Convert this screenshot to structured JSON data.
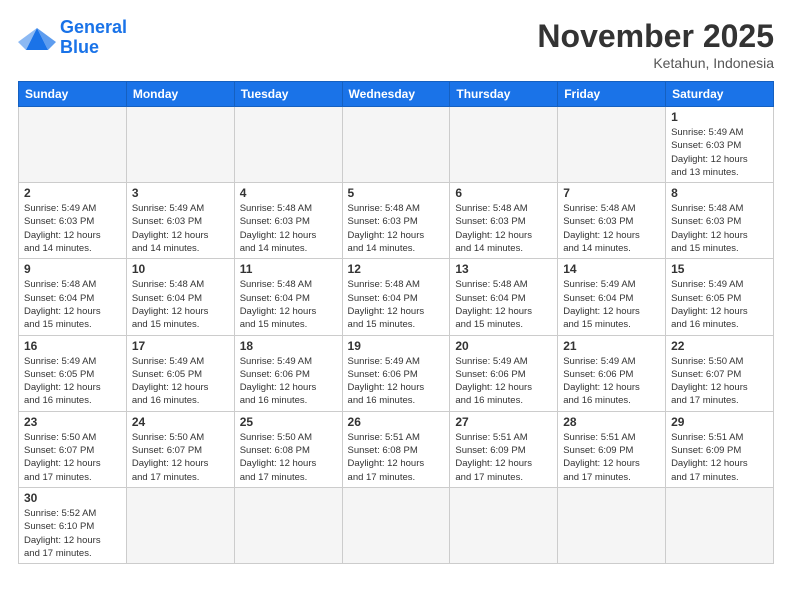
{
  "header": {
    "logo_general": "General",
    "logo_blue": "Blue",
    "month_title": "November 2025",
    "location": "Ketahun, Indonesia"
  },
  "weekdays": [
    "Sunday",
    "Monday",
    "Tuesday",
    "Wednesday",
    "Thursday",
    "Friday",
    "Saturday"
  ],
  "days": {
    "d1": {
      "num": "1",
      "info": "Sunrise: 5:49 AM\nSunset: 6:03 PM\nDaylight: 12 hours\nand 13 minutes."
    },
    "d2": {
      "num": "2",
      "info": "Sunrise: 5:49 AM\nSunset: 6:03 PM\nDaylight: 12 hours\nand 14 minutes."
    },
    "d3": {
      "num": "3",
      "info": "Sunrise: 5:49 AM\nSunset: 6:03 PM\nDaylight: 12 hours\nand 14 minutes."
    },
    "d4": {
      "num": "4",
      "info": "Sunrise: 5:48 AM\nSunset: 6:03 PM\nDaylight: 12 hours\nand 14 minutes."
    },
    "d5": {
      "num": "5",
      "info": "Sunrise: 5:48 AM\nSunset: 6:03 PM\nDaylight: 12 hours\nand 14 minutes."
    },
    "d6": {
      "num": "6",
      "info": "Sunrise: 5:48 AM\nSunset: 6:03 PM\nDaylight: 12 hours\nand 14 minutes."
    },
    "d7": {
      "num": "7",
      "info": "Sunrise: 5:48 AM\nSunset: 6:03 PM\nDaylight: 12 hours\nand 14 minutes."
    },
    "d8": {
      "num": "8",
      "info": "Sunrise: 5:48 AM\nSunset: 6:03 PM\nDaylight: 12 hours\nand 15 minutes."
    },
    "d9": {
      "num": "9",
      "info": "Sunrise: 5:48 AM\nSunset: 6:04 PM\nDaylight: 12 hours\nand 15 minutes."
    },
    "d10": {
      "num": "10",
      "info": "Sunrise: 5:48 AM\nSunset: 6:04 PM\nDaylight: 12 hours\nand 15 minutes."
    },
    "d11": {
      "num": "11",
      "info": "Sunrise: 5:48 AM\nSunset: 6:04 PM\nDaylight: 12 hours\nand 15 minutes."
    },
    "d12": {
      "num": "12",
      "info": "Sunrise: 5:48 AM\nSunset: 6:04 PM\nDaylight: 12 hours\nand 15 minutes."
    },
    "d13": {
      "num": "13",
      "info": "Sunrise: 5:48 AM\nSunset: 6:04 PM\nDaylight: 12 hours\nand 15 minutes."
    },
    "d14": {
      "num": "14",
      "info": "Sunrise: 5:49 AM\nSunset: 6:04 PM\nDaylight: 12 hours\nand 15 minutes."
    },
    "d15": {
      "num": "15",
      "info": "Sunrise: 5:49 AM\nSunset: 6:05 PM\nDaylight: 12 hours\nand 16 minutes."
    },
    "d16": {
      "num": "16",
      "info": "Sunrise: 5:49 AM\nSunset: 6:05 PM\nDaylight: 12 hours\nand 16 minutes."
    },
    "d17": {
      "num": "17",
      "info": "Sunrise: 5:49 AM\nSunset: 6:05 PM\nDaylight: 12 hours\nand 16 minutes."
    },
    "d18": {
      "num": "18",
      "info": "Sunrise: 5:49 AM\nSunset: 6:06 PM\nDaylight: 12 hours\nand 16 minutes."
    },
    "d19": {
      "num": "19",
      "info": "Sunrise: 5:49 AM\nSunset: 6:06 PM\nDaylight: 12 hours\nand 16 minutes."
    },
    "d20": {
      "num": "20",
      "info": "Sunrise: 5:49 AM\nSunset: 6:06 PM\nDaylight: 12 hours\nand 16 minutes."
    },
    "d21": {
      "num": "21",
      "info": "Sunrise: 5:49 AM\nSunset: 6:06 PM\nDaylight: 12 hours\nand 16 minutes."
    },
    "d22": {
      "num": "22",
      "info": "Sunrise: 5:50 AM\nSunset: 6:07 PM\nDaylight: 12 hours\nand 17 minutes."
    },
    "d23": {
      "num": "23",
      "info": "Sunrise: 5:50 AM\nSunset: 6:07 PM\nDaylight: 12 hours\nand 17 minutes."
    },
    "d24": {
      "num": "24",
      "info": "Sunrise: 5:50 AM\nSunset: 6:07 PM\nDaylight: 12 hours\nand 17 minutes."
    },
    "d25": {
      "num": "25",
      "info": "Sunrise: 5:50 AM\nSunset: 6:08 PM\nDaylight: 12 hours\nand 17 minutes."
    },
    "d26": {
      "num": "26",
      "info": "Sunrise: 5:51 AM\nSunset: 6:08 PM\nDaylight: 12 hours\nand 17 minutes."
    },
    "d27": {
      "num": "27",
      "info": "Sunrise: 5:51 AM\nSunset: 6:09 PM\nDaylight: 12 hours\nand 17 minutes."
    },
    "d28": {
      "num": "28",
      "info": "Sunrise: 5:51 AM\nSunset: 6:09 PM\nDaylight: 12 hours\nand 17 minutes."
    },
    "d29": {
      "num": "29",
      "info": "Sunrise: 5:51 AM\nSunset: 6:09 PM\nDaylight: 12 hours\nand 17 minutes."
    },
    "d30": {
      "num": "30",
      "info": "Sunrise: 5:52 AM\nSunset: 6:10 PM\nDaylight: 12 hours\nand 17 minutes."
    }
  }
}
